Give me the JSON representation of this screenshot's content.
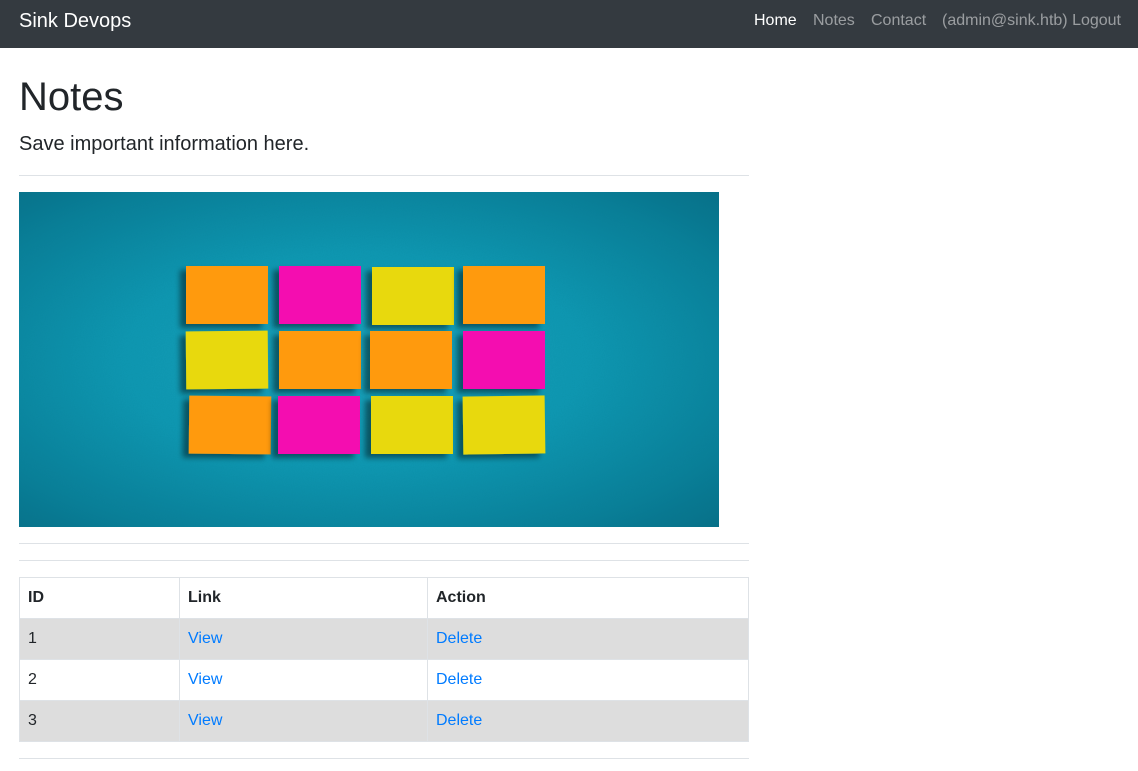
{
  "navbar": {
    "brand": "Sink Devops",
    "links": [
      {
        "label": "Home",
        "active": true
      },
      {
        "label": "Notes",
        "active": false
      },
      {
        "label": "Contact",
        "active": false
      },
      {
        "label": "(admin@sink.htb) Logout",
        "active": false
      }
    ]
  },
  "page": {
    "title": "Notes",
    "lead": "Save important information here."
  },
  "hero": {
    "image_name": "sticky-notes-image",
    "background_color": "#0f98b3",
    "note_colors": [
      [
        "#ff9a0e",
        "#f40ab0",
        "#e8d90a",
        "#ff9a0e"
      ],
      [
        "#e8d90a",
        "#ff9a0e",
        "#ff9a0e",
        "#f40ab0"
      ],
      [
        "#ff9a0e",
        "#f40ab0",
        "#e8d90a",
        "#e8d90a"
      ]
    ]
  },
  "table": {
    "headers": [
      "ID",
      "Link",
      "Action"
    ],
    "rows": [
      {
        "id": "1",
        "link": "View",
        "action": "Delete"
      },
      {
        "id": "2",
        "link": "View",
        "action": "Delete"
      },
      {
        "id": "3",
        "link": "View",
        "action": "Delete"
      }
    ]
  },
  "colors": {
    "navbar_bg": "#343a40",
    "link": "#007bff",
    "stripe": "#dddddd"
  }
}
